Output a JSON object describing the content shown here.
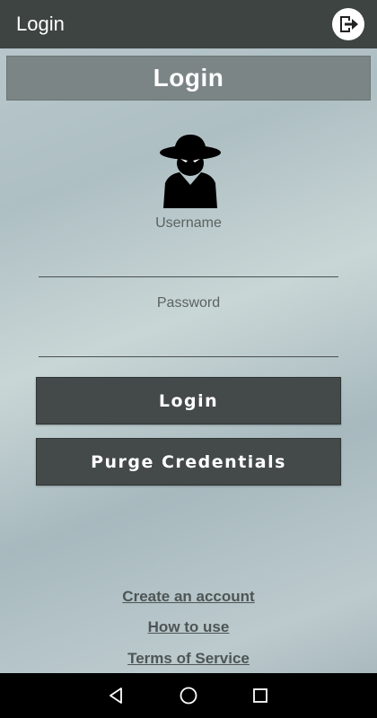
{
  "appbar": {
    "title": "Login",
    "exit_icon": "exit-icon"
  },
  "banner": {
    "title": "Login"
  },
  "avatar": {
    "icon": "spy-icon"
  },
  "form": {
    "username_label": "Username",
    "username_value": "",
    "password_label": "Password",
    "password_value": ""
  },
  "buttons": {
    "login_label": "Login",
    "purge_label": "Purge Credentials"
  },
  "links": {
    "create_account": "Create an account",
    "how_to_use": "How to use",
    "terms": "Terms of Service"
  },
  "navbar": {
    "back_icon": "back-icon",
    "home_icon": "home-icon",
    "recents_icon": "recents-icon"
  },
  "colors": {
    "appbar": "#3d4442",
    "banner": "#7b8585",
    "button": "#434a49",
    "link": "#4e5555"
  }
}
